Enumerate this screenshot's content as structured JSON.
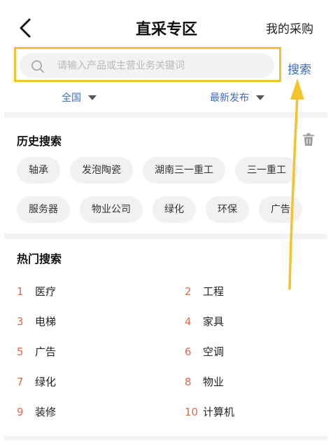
{
  "header": {
    "back_icon": "chevron-left-icon",
    "title": "直采专区",
    "my_purchase": "我的采购"
  },
  "search": {
    "placeholder": "请输入产品或主营业务关键词",
    "value": "",
    "button_label": "搜索",
    "icon": "search-icon",
    "highlight_color": "#f3c32d"
  },
  "filters": {
    "region": "全国",
    "sort": "最新发布"
  },
  "history": {
    "title": "历史搜索",
    "clear_icon": "trash-icon",
    "row1": [
      "轴承",
      "发泡陶瓷",
      "湖南三一重工",
      "三一重工"
    ],
    "row2": [
      "服务器",
      "物业公司",
      "绿化",
      "环保",
      "广告"
    ]
  },
  "hot": {
    "title": "热门搜索",
    "items": [
      {
        "rank": "1",
        "label": "医疗"
      },
      {
        "rank": "2",
        "label": "工程"
      },
      {
        "rank": "3",
        "label": "电梯"
      },
      {
        "rank": "4",
        "label": "家具"
      },
      {
        "rank": "5",
        "label": "广告"
      },
      {
        "rank": "6",
        "label": "空调"
      },
      {
        "rank": "7",
        "label": "绿化"
      },
      {
        "rank": "8",
        "label": "物业"
      },
      {
        "rank": "9",
        "label": "装修"
      },
      {
        "rank": "10",
        "label": "计算机"
      }
    ]
  },
  "colors": {
    "accent_blue": "#3d6bc7",
    "rank_orange": "#e0684b",
    "annotation_yellow": "#f3c32d"
  }
}
